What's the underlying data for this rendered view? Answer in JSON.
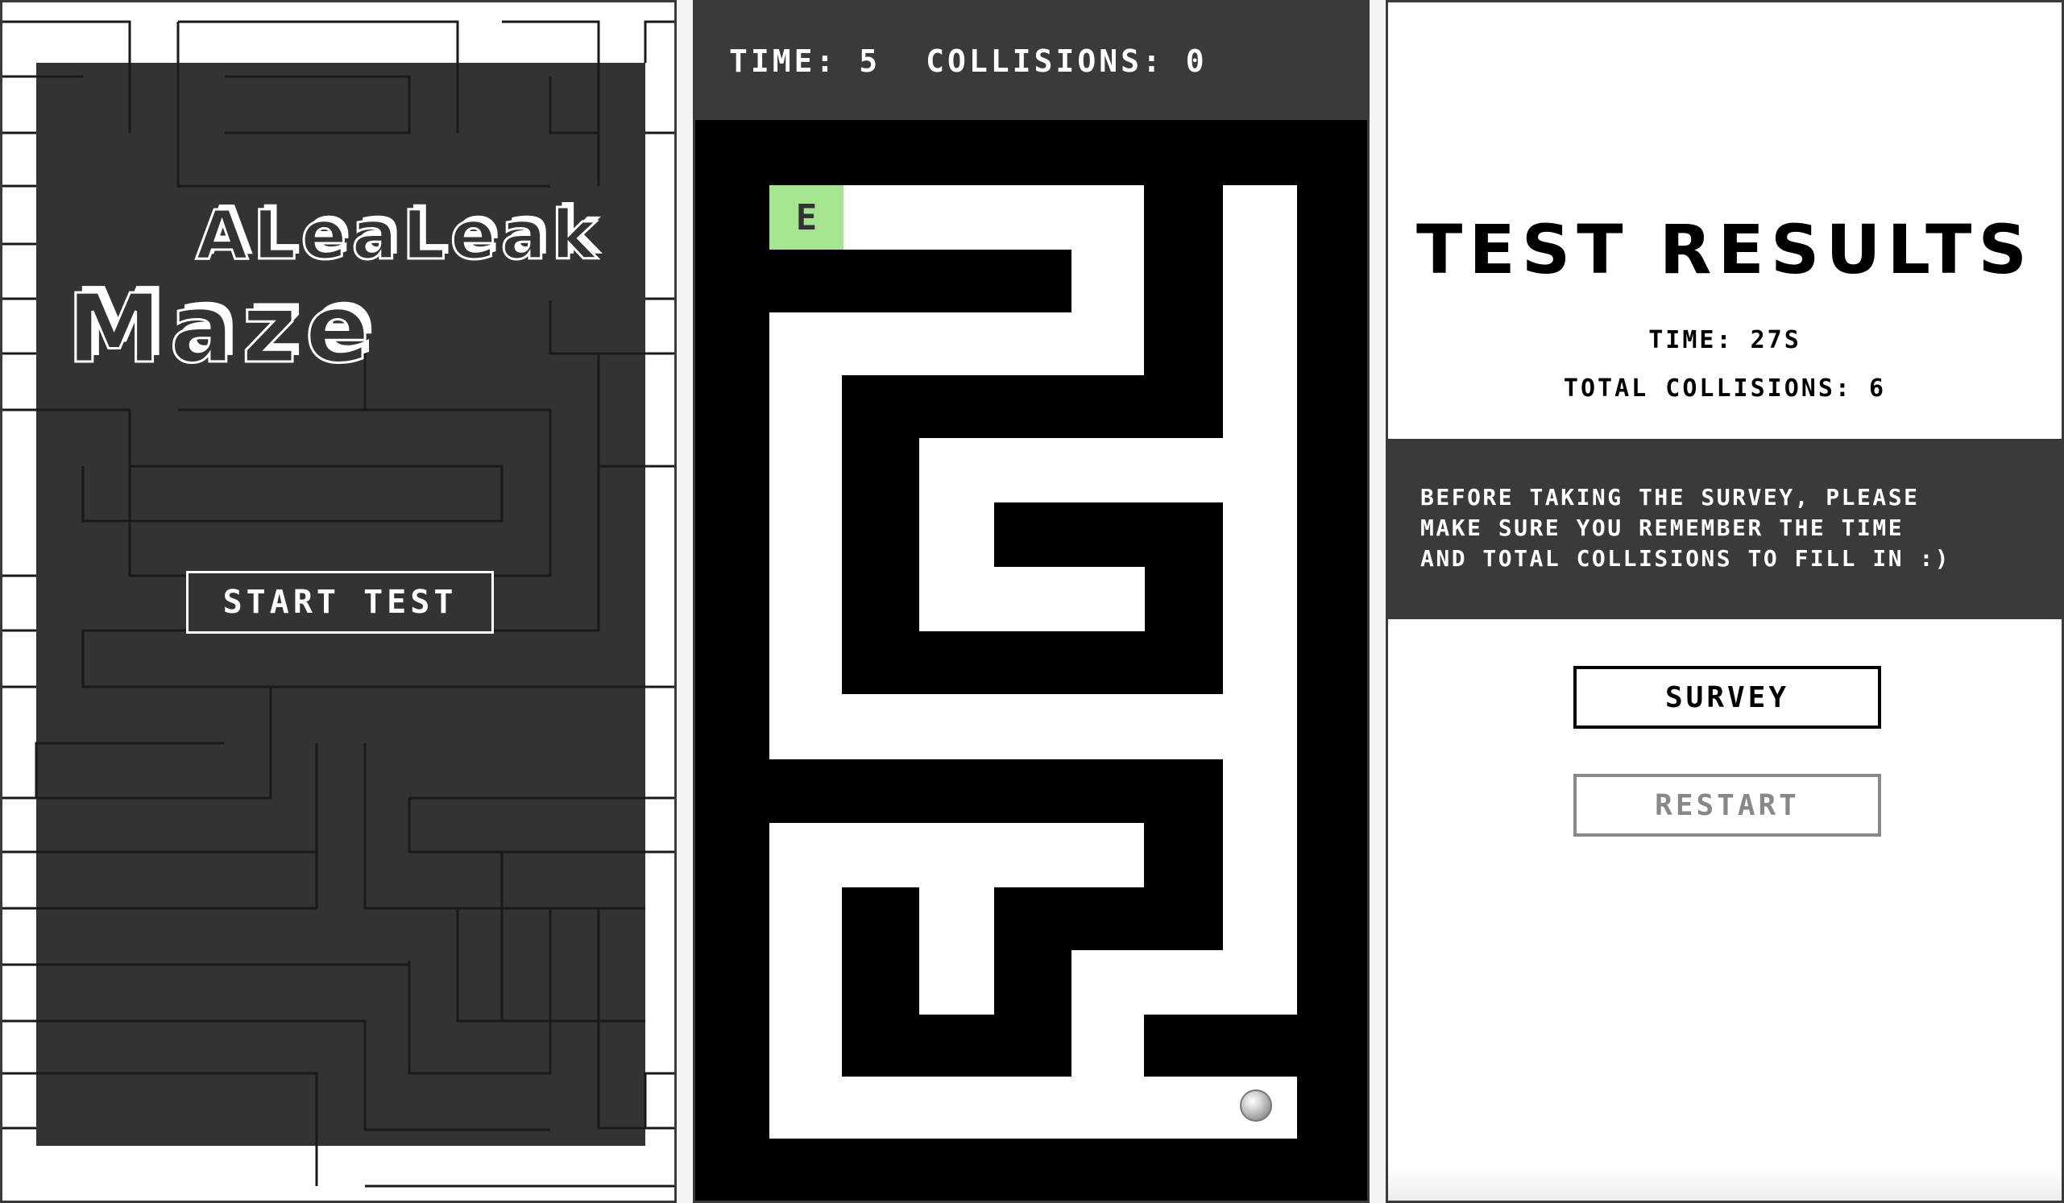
{
  "title_screen": {
    "logo_line1": "ALeaLeak",
    "logo_line2": "Maze",
    "start_button": "START TEST"
  },
  "game": {
    "time_label": "TIME:",
    "time_value": "5",
    "collisions_label": "COLLISIONS:",
    "collisions_value": "0",
    "exit_label": "E"
  },
  "results": {
    "title": "TEST RESULTS",
    "time_line": "TIME: 27S",
    "collisions_line": "TOTAL COLLISIONS: 6",
    "notice_line1": "BEFORE TAKING THE SURVEY, PLEASE",
    "notice_line2": "MAKE SURE YOU REMEMBER THE TIME",
    "notice_line3": "AND TOTAL COLLISIONS TO FILL IN :)",
    "survey_button": "SURVEY",
    "restart_button": "RESTART"
  },
  "colors": {
    "panel_dark": "#3a3a3a",
    "maze_path": "#ffffff",
    "maze_wall": "#000000",
    "exit_tile": "#a6e58f",
    "disabled_button": "#888888"
  }
}
